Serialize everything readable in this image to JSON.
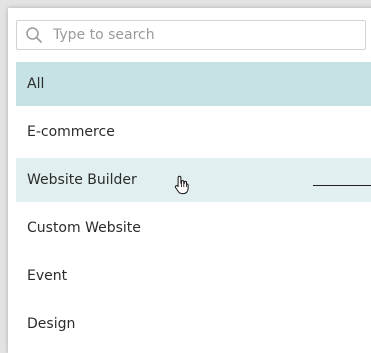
{
  "search": {
    "placeholder": "Type to search",
    "value": ""
  },
  "list": {
    "items": [
      {
        "label": "All",
        "state": "selected"
      },
      {
        "label": "E-commerce",
        "state": "normal"
      },
      {
        "label": "Website Builder",
        "state": "hovered"
      },
      {
        "label": "Custom Website",
        "state": "normal"
      },
      {
        "label": "Event",
        "state": "normal"
      },
      {
        "label": "Design",
        "state": "normal"
      }
    ]
  },
  "colors": {
    "selected_bg": "#c6e2e4",
    "hover_bg": "#e1eff0",
    "text": "#2b2b2b",
    "placeholder": "#9a9a9a"
  },
  "icons": {
    "search": "search-icon",
    "cursor": "hand-pointer-cursor-icon"
  }
}
